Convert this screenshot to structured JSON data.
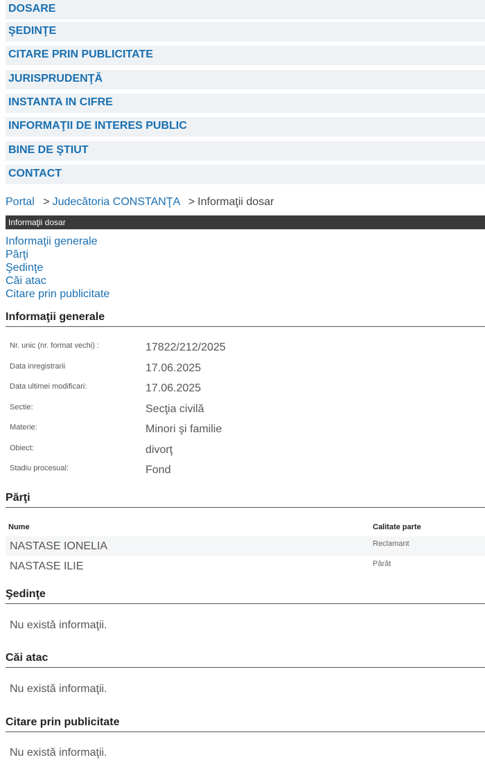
{
  "nav": {
    "items": [
      {
        "label": "DOSARE"
      },
      {
        "label": "ŞEDINŢE"
      },
      {
        "label": "CITARE PRIN PUBLICITATE"
      },
      {
        "label": "JURISPRUDENŢĂ"
      },
      {
        "label": "INSTANTA IN CIFRE"
      },
      {
        "label": "INFORMAŢII DE INTERES PUBLIC"
      },
      {
        "label": "BINE DE ŞTIUT"
      },
      {
        "label": "CONTACT"
      }
    ]
  },
  "breadcrumb": {
    "portal": "Portal",
    "separator": ">",
    "court": "Judecătoria CONSTANŢA",
    "current": "Informaţii dosar"
  },
  "header_bar": {
    "title": "Informaţii dosar"
  },
  "toc": {
    "items": [
      "Informaţii generale",
      "Părţi",
      "Şedinţe",
      "Căi atac",
      "Citare prin publicitate"
    ]
  },
  "general": {
    "title": "Informaţii generale",
    "fields": [
      {
        "label": "Nr. unic (nr. format vechi) :",
        "value": "17822/212/2025"
      },
      {
        "label": "Data inregistrarii",
        "value": "17.06.2025"
      },
      {
        "label": "Data ultimei modificari:",
        "value": "17.06.2025"
      },
      {
        "label": "Sectie:",
        "value": "Secţia civilă"
      },
      {
        "label": "Materie:",
        "value": "Minori şi familie"
      },
      {
        "label": "Obiect:",
        "value": "divorţ"
      },
      {
        "label": "Stadiu procesual:",
        "value": "Fond"
      }
    ]
  },
  "parti": {
    "title": "Părţi",
    "col_name": "Nume",
    "col_role": "Calitate parte",
    "rows": [
      {
        "name": "NASTASE IONELIA",
        "role": "Reclamant"
      },
      {
        "name": "NASTASE ILIE",
        "role": "Pârât"
      }
    ]
  },
  "sedinte": {
    "title": "Şedinţe",
    "empty": "Nu există informaţii."
  },
  "cai_atac": {
    "title": "Căi atac",
    "empty": "Nu există informaţii."
  },
  "citare": {
    "title": "Citare prin publicitate",
    "empty": "Nu există informaţii."
  }
}
